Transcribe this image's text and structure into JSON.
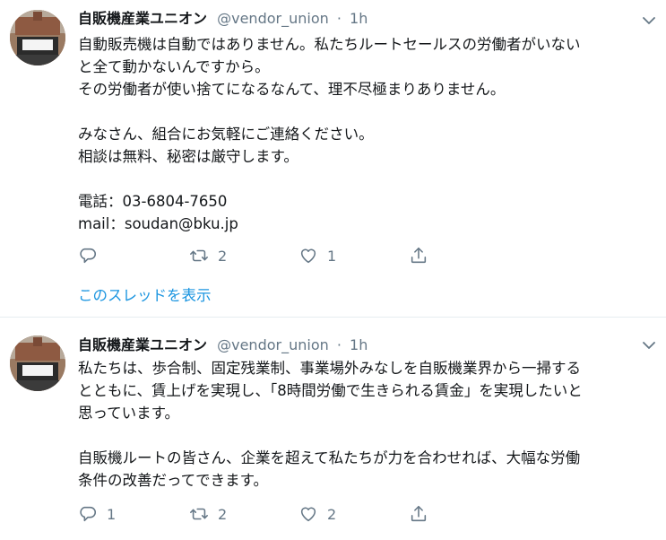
{
  "tweets": [
    {
      "author_name": "自販機産業ユニオン",
      "handle": "@vendor_union",
      "separator": "·",
      "time": "1h",
      "lines": [
        "自動販売機は自動ではありません。私たちルートセールスの労働者がいない",
        "と全て動かないんですから。",
        "その労働者が使い捨てになるなんて、理不尽極まりありません。",
        "",
        "みなさん、組合にお気軽にご連絡ください。",
        "相談は無料、秘密は厳守します。",
        "",
        "電話：03-6804-7650",
        "mail：soudan@bku.jp"
      ],
      "reply_count": "",
      "retweet_count": "2",
      "like_count": "1",
      "thread_link": "このスレッドを表示"
    },
    {
      "author_name": "自販機産業ユニオン",
      "handle": "@vendor_union",
      "separator": "·",
      "time": "1h",
      "lines": [
        "私たちは、歩合制、固定残業制、事業場外みなしを自販機業界から一掃する",
        "とともに、賃上げを実現し、「8時間労働で生きられる賃金」を実現したいと",
        "思っています。",
        "",
        "自販機ルートの皆さん、企業を超えて私たちが力を合わせれば、大幅な労働",
        "条件の改善だってできます。"
      ],
      "reply_count": "1",
      "retweet_count": "2",
      "like_count": "2"
    }
  ],
  "icons": {
    "reply": "reply-icon",
    "retweet": "retweet-icon",
    "like": "heart-icon",
    "share": "share-icon",
    "caret": "chevron-down-icon"
  },
  "colors": {
    "text": "#14171a",
    "muted": "#657786",
    "link": "#1b95e0",
    "divider": "#e6ecf0"
  }
}
